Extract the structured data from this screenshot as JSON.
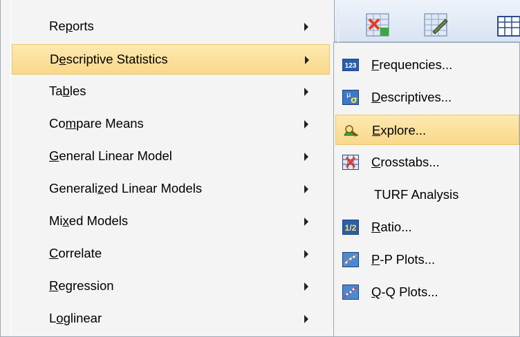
{
  "main_menu": {
    "items": [
      {
        "label": "Reports",
        "underline": "p"
      },
      {
        "label": "Descriptive Statistics",
        "underline": "e"
      },
      {
        "label": "Tables",
        "underline": "b"
      },
      {
        "label": "Compare Means",
        "underline": "m"
      },
      {
        "label": "General Linear Model",
        "underline": "G"
      },
      {
        "label": "Generalized Linear Models",
        "underline": "z"
      },
      {
        "label": "Mixed Models",
        "underline": "x"
      },
      {
        "label": "Correlate",
        "underline": "C"
      },
      {
        "label": "Regression",
        "underline": "R"
      },
      {
        "label": "Loglinear",
        "underline": "o"
      }
    ],
    "active_item": "Descriptive Statistics"
  },
  "submenu": {
    "items": [
      {
        "label": "Frequencies...",
        "icon": "frequencies-icon"
      },
      {
        "label": "Descriptives...",
        "icon": "descriptives-icon"
      },
      {
        "label": "Explore...",
        "icon": "explore-icon"
      },
      {
        "label": "Crosstabs...",
        "icon": "crosstabs-icon"
      },
      {
        "label": "TURF Analysis",
        "icon": ""
      },
      {
        "label": "Ratio...",
        "icon": "ratio-icon"
      },
      {
        "label": "P-P Plots...",
        "icon": "pp-plots-icon"
      },
      {
        "label": "Q-Q Plots...",
        "icon": "qq-plots-icon"
      }
    ],
    "active_item": "Explore..."
  },
  "icon_text": {
    "frequencies": "123",
    "descriptives_mu": "μ",
    "descriptives_sigma": "σ",
    "ratio": "1/2"
  },
  "colors": {
    "highlight": "#f9d88a",
    "menu_bg": "#f4f4f4",
    "border": "#9aa7b8"
  }
}
